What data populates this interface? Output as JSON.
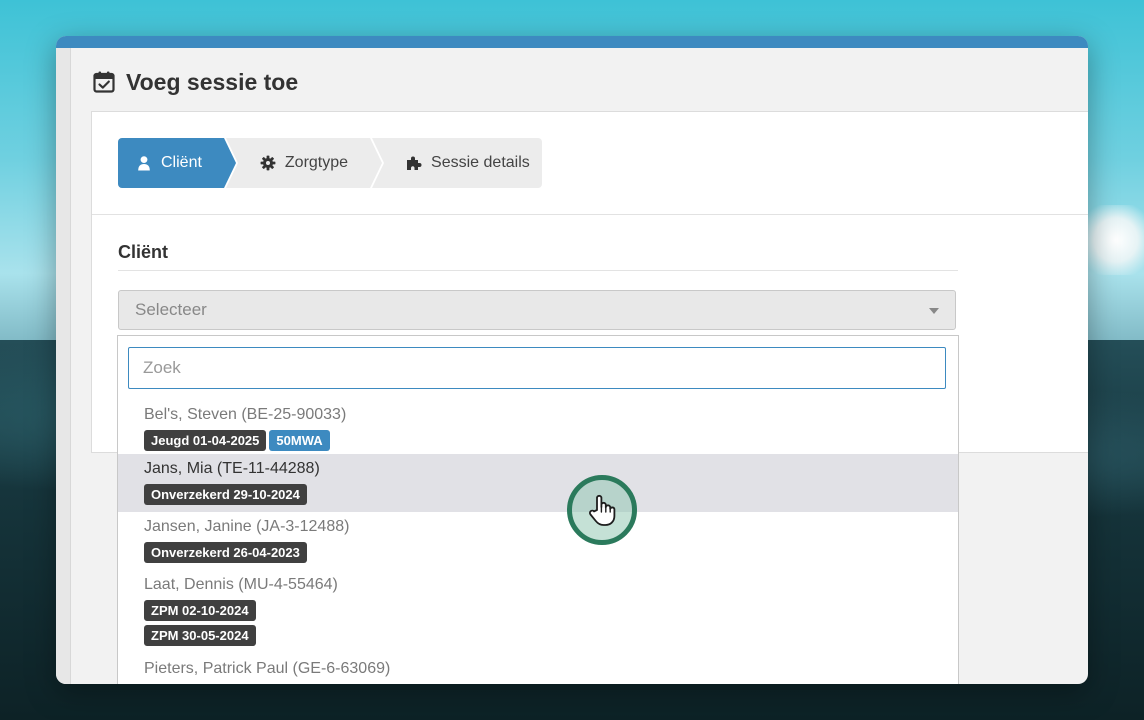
{
  "page": {
    "title": "Voeg sessie toe",
    "title_icon": "calendar-check-icon"
  },
  "steps": [
    {
      "label": "Cliënt",
      "icon": "user-icon",
      "active": true
    },
    {
      "label": "Zorgtype",
      "icon": "gear-icon",
      "active": false
    },
    {
      "label": "Sessie details",
      "icon": "puzzle-icon",
      "active": false
    }
  ],
  "client_field": {
    "label": "Cliënt",
    "select_placeholder": "Selecteer"
  },
  "dropdown": {
    "search_placeholder": "Zoek",
    "options": [
      {
        "name": "Bel's, Steven (BE-25-90033)",
        "badges": [
          [
            "Jeugd 01-04-2025",
            "50MWA"
          ]
        ]
      },
      {
        "name": "Jans, Mia (TE-11-44288)",
        "badges": [
          [
            "Onverzekerd 29-10-2024"
          ]
        ],
        "highlighted": true
      },
      {
        "name": "Jansen, Janine (JA-3-12488)",
        "badges": [
          [
            "Onverzekerd 26-04-2023"
          ]
        ]
      },
      {
        "name": "Laat, Dennis (MU-4-55464)",
        "badges": [
          [
            "ZPM 02-10-2024"
          ],
          [
            "ZPM 30-05-2024"
          ]
        ]
      },
      {
        "name": "Pieters, Patrick Paul (GE-6-63069)",
        "badges": []
      }
    ]
  },
  "colors": {
    "accent": "#3d8ac0",
    "badge_dark": "#404040",
    "cursor_ring": "#2b7a5c"
  }
}
